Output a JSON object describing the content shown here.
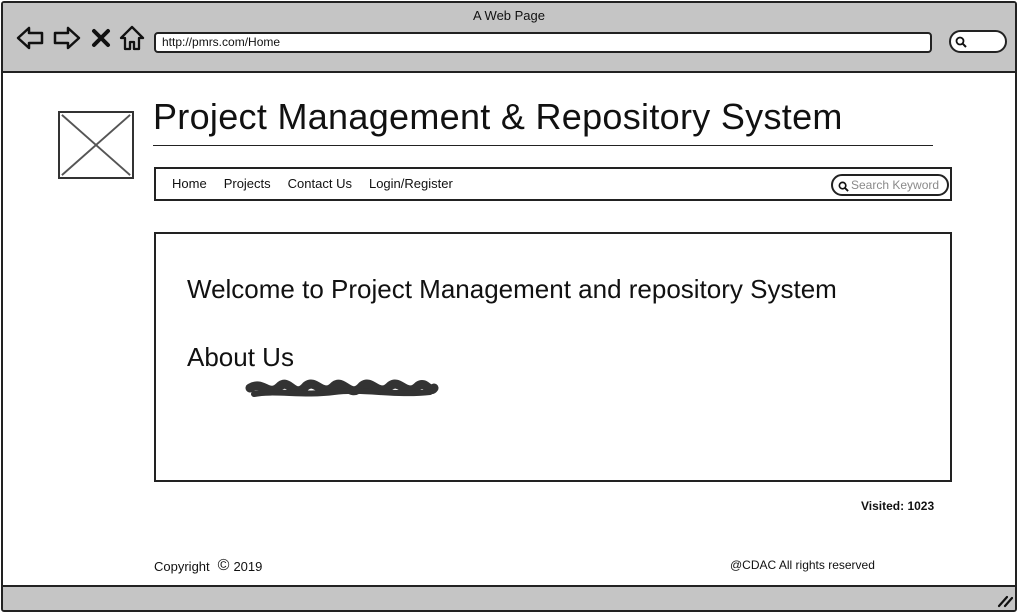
{
  "window": {
    "title": "A Web Page"
  },
  "browser": {
    "url": "http://pmrs.com/Home",
    "icons": [
      "back-arrow-icon",
      "forward-arrow-icon",
      "close-x-icon",
      "home-icon",
      "search-icon"
    ]
  },
  "header": {
    "logo_icon": "image-placeholder-icon",
    "site_title": "Project Management & Repository System"
  },
  "nav": {
    "items": [
      {
        "label": "Home"
      },
      {
        "label": "Projects"
      },
      {
        "label": "Contact Us"
      },
      {
        "label": "Login/Register"
      }
    ],
    "search_placeholder": "Search Keyword"
  },
  "main": {
    "welcome": "Welcome to Project Management and repository System",
    "about_heading": "About Us"
  },
  "stats": {
    "visited": "Visited: 1023"
  },
  "footer": {
    "copyright_label": "Copyright",
    "copyright_symbol": "©",
    "year": "2019",
    "rights": "@CDAC All rights reserved"
  },
  "colors": {
    "chrome": "#c5c5c5",
    "border": "#222222",
    "text": "#111111"
  }
}
